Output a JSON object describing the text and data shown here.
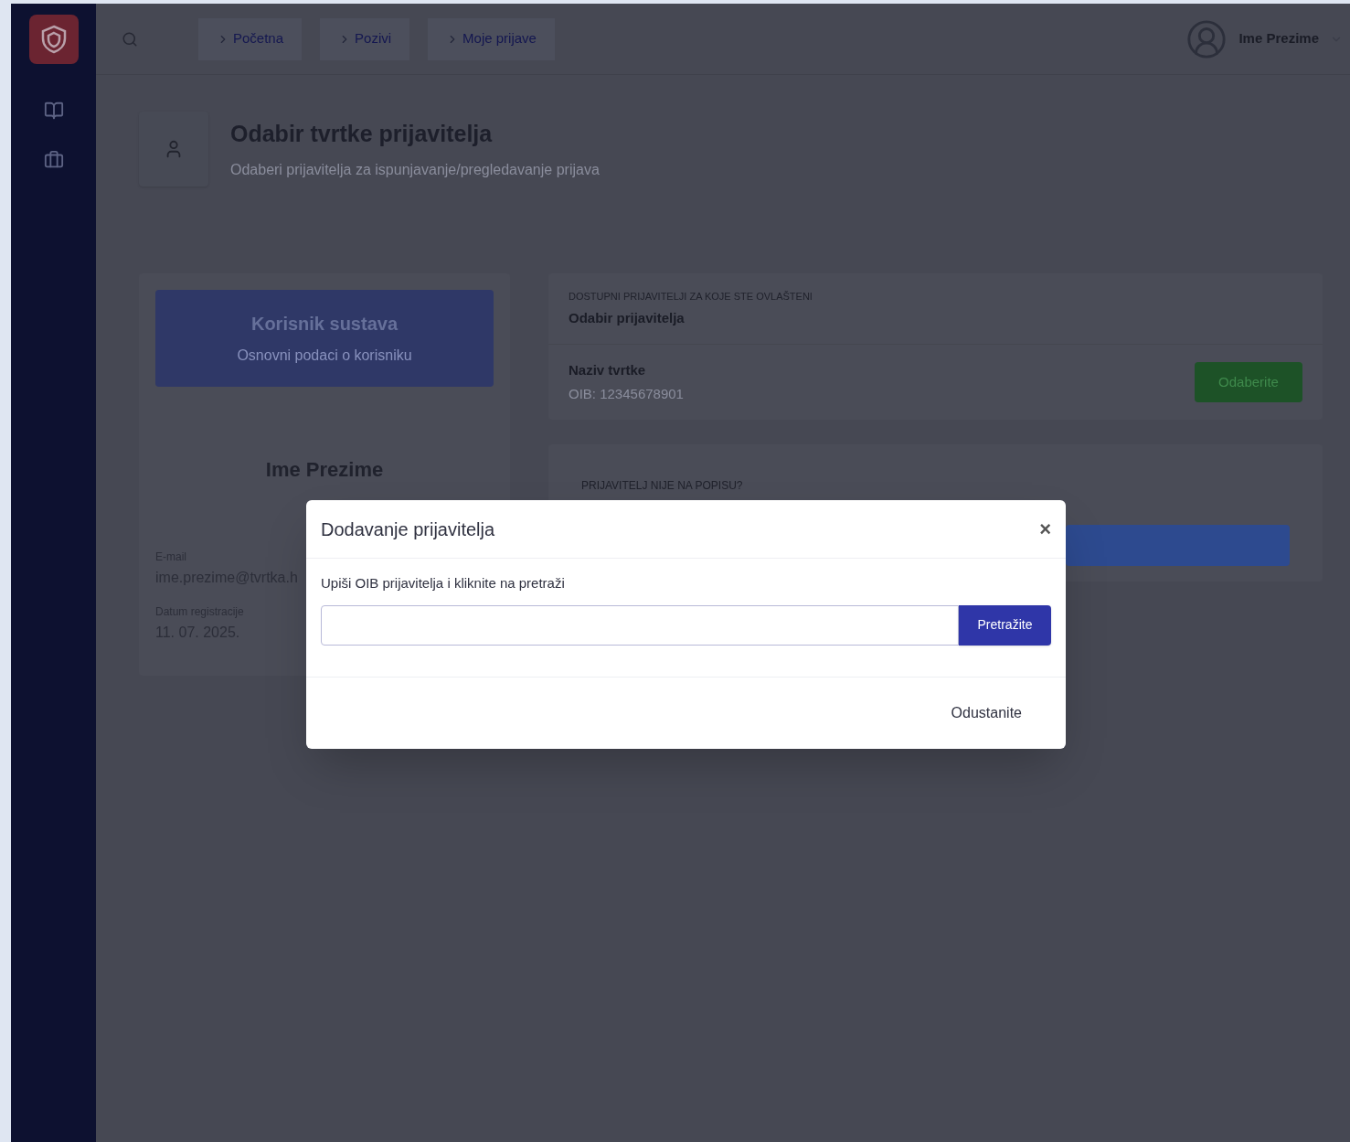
{
  "header": {
    "breadcrumbs": [
      {
        "label": "Početna"
      },
      {
        "label": "Pozivi"
      },
      {
        "label": "Moje prijave"
      }
    ],
    "user_name": "Ime Prezime"
  },
  "page": {
    "title": "Odabir tvrtke prijavitelja",
    "subtitle": "Odaberi prijavitelja za ispunjavanje/pregledavanje prijava"
  },
  "profile_card": {
    "banner_title": "Korisnik sustava",
    "banner_subtitle": "Osnovni podaci o korisniku",
    "name": "Ime Prezime",
    "fields": [
      {
        "label": "E-mail",
        "value": "ime.prezime@tvrtka.h"
      },
      {
        "label": "Datum registracije",
        "value": "11. 07. 2025."
      }
    ]
  },
  "applicants_card": {
    "overline": "DOSTUPNI PRIJAVITELJI ZA KOJE STE OVLAŠTENI",
    "title": "Odabir prijavitelja",
    "rows": [
      {
        "name": "Naziv tvrtke",
        "oib": "OIB: 12345678901",
        "button": "Odaberite"
      }
    ]
  },
  "missing_card": {
    "overline": "PRIJAVITELJ NIJE NA POPISU?"
  },
  "dialog": {
    "title": "Dodavanje prijavitelja",
    "close": "×",
    "instruction": "Upiši OIB prijavitelja i kliknite na pretraži",
    "search_button": "Pretražite",
    "cancel_button": "Odustanite"
  }
}
